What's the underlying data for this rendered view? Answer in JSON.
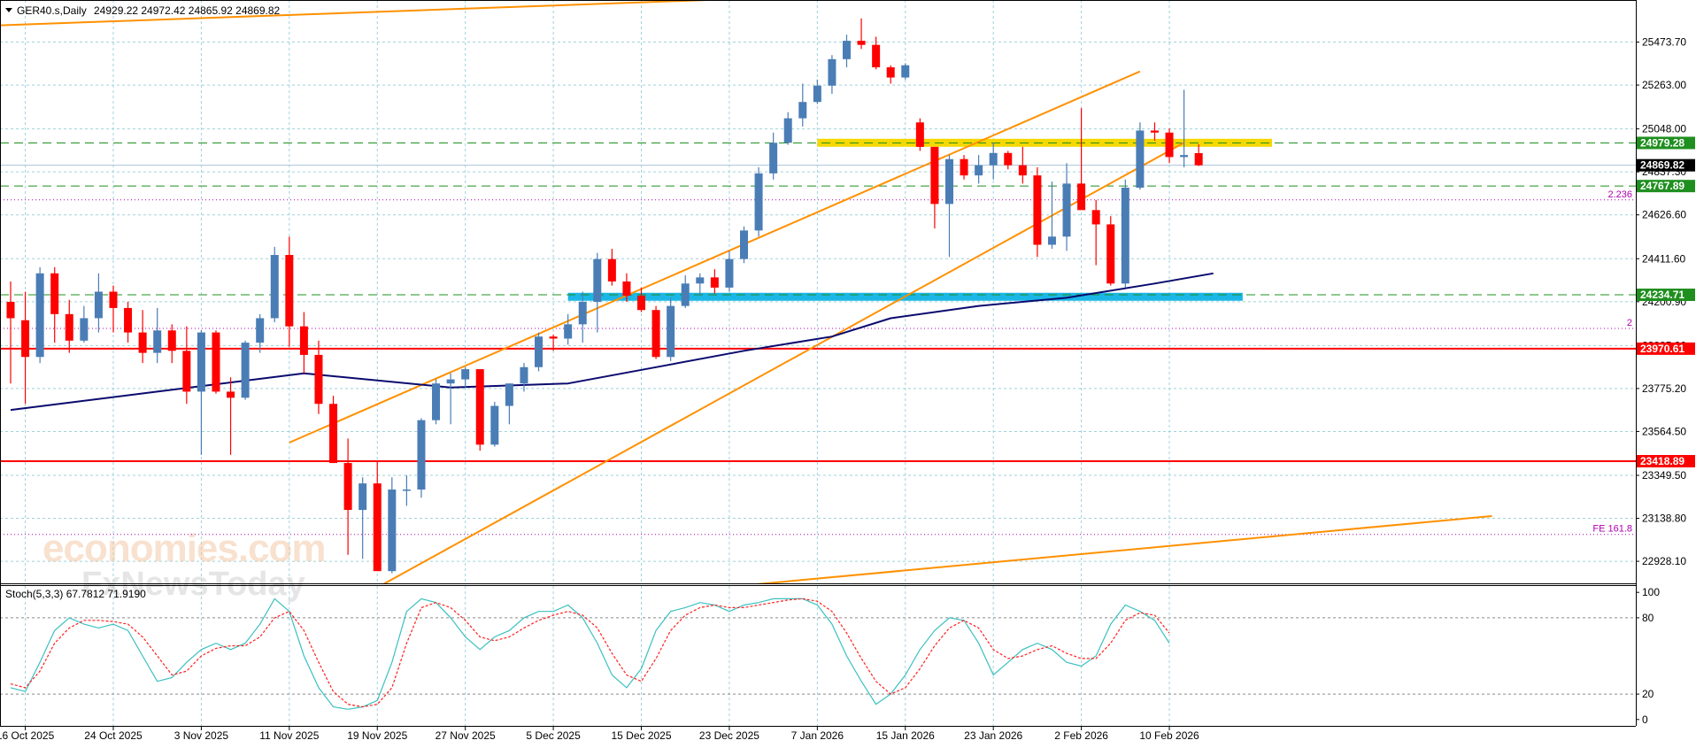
{
  "header": {
    "symbol_label": "GER40.s,Daily",
    "ohlc": "24929.22 24972.42 24865.92 24869.82"
  },
  "watermark": {
    "line1": "economies.com",
    "line2": "FxNewsToday"
  },
  "indicator": {
    "label": "Stoch(5,3,3) 67.7812 71.9190"
  },
  "colors": {
    "bull": "#4a7db5",
    "bear": "#ff0000",
    "channel": "#ff9000",
    "ma": "#0a0a6e",
    "green_level": "#1f8f1f",
    "red_level": "#ff0000",
    "fib": "#b000b0",
    "zone_top": "#f5d800",
    "zone_bottom": "#1ab6e6",
    "stoch_k": "#3cc0c0",
    "stoch_d": "#ff2020",
    "grid": "#9fd2dc"
  },
  "chart_data": [
    {
      "type": "candlestick",
      "title": "GER40.s,Daily",
      "ylim": [
        22820,
        25680
      ],
      "y_ticks": [
        "25473.70",
        "25263.00",
        "25048.00",
        "24837.30",
        "24626.60",
        "24411.60",
        "24200.90",
        "23985.90",
        "23775.20",
        "23564.50",
        "23349.50",
        "23138.80",
        "22928.10"
      ],
      "x_ticks": [
        {
          "idx": 1,
          "label": "16 Oct 2025"
        },
        {
          "idx": 7,
          "label": "24 Oct 2025"
        },
        {
          "idx": 13,
          "label": "3 Nov 2025"
        },
        {
          "idx": 19,
          "label": "11 Nov 2025"
        },
        {
          "idx": 25,
          "label": "19 Nov 2025"
        },
        {
          "idx": 31,
          "label": "27 Nov 2025"
        },
        {
          "idx": 37,
          "label": "5 Dec 2025"
        },
        {
          "idx": 43,
          "label": "15 Dec 2025"
        },
        {
          "idx": 49,
          "label": "23 Dec 2025"
        },
        {
          "idx": 55,
          "label": "7 Jan 2026"
        },
        {
          "idx": 61,
          "label": "15 Jan 2026"
        },
        {
          "idx": 67,
          "label": "23 Jan 2026"
        },
        {
          "idx": 73,
          "label": "2 Feb 2026"
        },
        {
          "idx": 79,
          "label": "10 Feb 2026"
        }
      ],
      "candles": [
        [
          24200,
          24300,
          23800,
          24120
        ],
        [
          24110,
          24250,
          23700,
          23930
        ],
        [
          23930,
          24370,
          23900,
          24340
        ],
        [
          24340,
          24370,
          24000,
          24140
        ],
        [
          24140,
          24210,
          23950,
          24010
        ],
        [
          24010,
          24180,
          24000,
          24120
        ],
        [
          24120,
          24340,
          24050,
          24250
        ],
        [
          24250,
          24280,
          24050,
          24170
        ],
        [
          24170,
          24200,
          24000,
          24050
        ],
        [
          24050,
          24160,
          23900,
          23950
        ],
        [
          23950,
          24170,
          23900,
          24060
        ],
        [
          24060,
          24090,
          23900,
          23960
        ],
        [
          23960,
          24080,
          23700,
          23760
        ],
        [
          23760,
          24060,
          23450,
          24050
        ],
        [
          24050,
          24060,
          23750,
          23760
        ],
        [
          23760,
          23830,
          23450,
          23730
        ],
        [
          23730,
          24010,
          23720,
          24000
        ],
        [
          24000,
          24140,
          23950,
          24120
        ],
        [
          24120,
          24470,
          24100,
          24430
        ],
        [
          24430,
          24520,
          23980,
          24080
        ],
        [
          24080,
          24150,
          23850,
          23940
        ],
        [
          23940,
          24010,
          23650,
          23700
        ],
        [
          23700,
          23740,
          23410,
          23410
        ],
        [
          23410,
          23530,
          22960,
          23180
        ],
        [
          23180,
          23340,
          22940,
          23310
        ],
        [
          23310,
          23420,
          22880,
          22880
        ],
        [
          22880,
          23340,
          22870,
          23280
        ],
        [
          23280,
          23350,
          23200,
          23280
        ],
        [
          23280,
          23630,
          23240,
          23620
        ],
        [
          23620,
          23820,
          23600,
          23800
        ],
        [
          23800,
          23850,
          23600,
          23820
        ],
        [
          23820,
          23880,
          23780,
          23870
        ],
        [
          23870,
          23870,
          23470,
          23500
        ],
        [
          23500,
          23710,
          23490,
          23690
        ],
        [
          23690,
          23800,
          23600,
          23800
        ],
        [
          23800,
          23900,
          23760,
          23880
        ],
        [
          23880,
          24050,
          23860,
          24030
        ],
        [
          24030,
          24040,
          23960,
          24020
        ],
        [
          24020,
          24140,
          23990,
          24090
        ],
        [
          24090,
          24250,
          24000,
          24200
        ],
        [
          24200,
          24440,
          24050,
          24410
        ],
        [
          24410,
          24460,
          24280,
          24300
        ],
        [
          24300,
          24340,
          24200,
          24230
        ],
        [
          24230,
          24270,
          24150,
          24160
        ],
        [
          24160,
          24180,
          23920,
          23930
        ],
        [
          23930,
          24220,
          23910,
          24180
        ],
        [
          24180,
          24330,
          24170,
          24290
        ],
        [
          24290,
          24340,
          24230,
          24320
        ],
        [
          24320,
          24360,
          24240,
          24270
        ],
        [
          24270,
          24450,
          24250,
          24410
        ],
        [
          24410,
          24570,
          24390,
          24550
        ],
        [
          24550,
          24860,
          24520,
          24830
        ],
        [
          24830,
          25030,
          24800,
          24980
        ],
        [
          24980,
          25130,
          24970,
          25100
        ],
        [
          25100,
          25270,
          25060,
          25180
        ],
        [
          25180,
          25290,
          25170,
          25260
        ],
        [
          25260,
          25410,
          25220,
          25390
        ],
        [
          25390,
          25510,
          25350,
          25480
        ],
        [
          25480,
          25590,
          25440,
          25460
        ],
        [
          25460,
          25500,
          25340,
          25350
        ],
        [
          25350,
          25360,
          25270,
          25300
        ],
        [
          25300,
          25370,
          25290,
          25360
        ],
        [
          25080,
          25100,
          24940,
          24960
        ],
        [
          24960,
          24960,
          24560,
          24680
        ],
        [
          24680,
          24920,
          24420,
          24900
        ],
        [
          24900,
          24920,
          24800,
          24820
        ],
        [
          24820,
          24920,
          24780,
          24870
        ],
        [
          24870,
          24980,
          24800,
          24930
        ],
        [
          24930,
          24940,
          24850,
          24870
        ],
        [
          24870,
          24960,
          24780,
          24820
        ],
        [
          24820,
          24860,
          24420,
          24480
        ],
        [
          24480,
          24790,
          24460,
          24520
        ],
        [
          24520,
          24880,
          24450,
          24780
        ],
        [
          24780,
          25150,
          24680,
          24650
        ],
        [
          24650,
          24700,
          24380,
          24580
        ],
        [
          24580,
          24620,
          24280,
          24290
        ],
        [
          24290,
          24800,
          24270,
          24760
        ],
        [
          24760,
          25080,
          24750,
          25040
        ],
        [
          25040,
          25080,
          24990,
          25030
        ],
        [
          25030,
          25050,
          24880,
          24910
        ],
        [
          24910,
          25240,
          24860,
          24920
        ],
        [
          24929.22,
          24972.42,
          24865.92,
          24869.82
        ]
      ],
      "ma": [
        [
          0,
          23670
        ],
        [
          10,
          23760
        ],
        [
          20,
          23850
        ],
        [
          30,
          23780
        ],
        [
          38,
          23800
        ],
        [
          44,
          23880
        ],
        [
          50,
          23960
        ],
        [
          56,
          24030
        ],
        [
          60,
          24120
        ],
        [
          66,
          24180
        ],
        [
          72,
          24220
        ],
        [
          78,
          24290
        ],
        [
          82,
          24340
        ]
      ],
      "levels": [
        {
          "price": 24979.28,
          "label": "24979.28",
          "style": "green-dash"
        },
        {
          "price": 24869.82,
          "label": "24869.82",
          "style": "current"
        },
        {
          "price": 24767.89,
          "label": "24767.89",
          "style": "green-dash"
        },
        {
          "price": 24234.71,
          "label": "24234.71",
          "style": "green-dash"
        },
        {
          "price": 23970.61,
          "label": "23970.61",
          "style": "red-solid"
        },
        {
          "price": 23418.89,
          "label": "23418.89",
          "style": "red-solid"
        }
      ],
      "fib_lines": [
        {
          "price": 24700,
          "label": "2.236"
        },
        {
          "price": 24070,
          "label": "2"
        },
        {
          "price": 23060,
          "label": "FE 161.8"
        }
      ],
      "zones": [
        {
          "price": 24980,
          "from": 55,
          "to": 86,
          "color": "zone_top"
        },
        {
          "price": 24225,
          "from": 38,
          "to": 84,
          "color": "zone_bottom"
        }
      ],
      "trendlines": [
        {
          "i1": -1,
          "p1": 25555,
          "i2": 63,
          "p2": 25720
        },
        {
          "i1": 19,
          "p1": 23510,
          "i2": 77,
          "p2": 25330
        },
        {
          "i1": 24,
          "p1": 22760,
          "i2": 80,
          "p2": 24980
        },
        {
          "i1": 47,
          "p1": 22790,
          "i2": 101,
          "p2": 23150
        }
      ]
    },
    {
      "type": "line",
      "title": "Stoch(5,3,3)",
      "ylim": [
        -5,
        105
      ],
      "y_ticks": [
        "100",
        "80",
        "20",
        "0"
      ],
      "series": [
        {
          "key": "k",
          "values": [
            25,
            22,
            45,
            70,
            80,
            75,
            72,
            75,
            70,
            50,
            30,
            33,
            45,
            55,
            60,
            55,
            60,
            75,
            95,
            85,
            50,
            25,
            10,
            8,
            10,
            15,
            45,
            85,
            95,
            92,
            80,
            65,
            55,
            65,
            70,
            80,
            85,
            85,
            90,
            80,
            60,
            35,
            25,
            40,
            70,
            85,
            88,
            92,
            90,
            85,
            90,
            92,
            95,
            95,
            95,
            90,
            75,
            50,
            30,
            12,
            20,
            35,
            55,
            70,
            80,
            78,
            60,
            35,
            45,
            55,
            60,
            55,
            45,
            42,
            50,
            75,
            90,
            85,
            78,
            60
          ]
        },
        {
          "key": "d",
          "values": [
            28,
            25,
            38,
            60,
            72,
            78,
            78,
            77,
            75,
            65,
            50,
            35,
            38,
            50,
            56,
            58,
            58,
            65,
            80,
            85,
            70,
            45,
            22,
            12,
            10,
            12,
            25,
            60,
            88,
            92,
            88,
            78,
            65,
            62,
            65,
            72,
            78,
            82,
            85,
            82,
            72,
            52,
            35,
            30,
            48,
            70,
            82,
            88,
            90,
            88,
            88,
            90,
            92,
            94,
            95,
            93,
            85,
            68,
            48,
            30,
            20,
            25,
            40,
            58,
            72,
            78,
            72,
            55,
            48,
            50,
            55,
            58,
            52,
            48,
            48,
            60,
            78,
            84,
            82,
            68
          ]
        }
      ]
    }
  ]
}
